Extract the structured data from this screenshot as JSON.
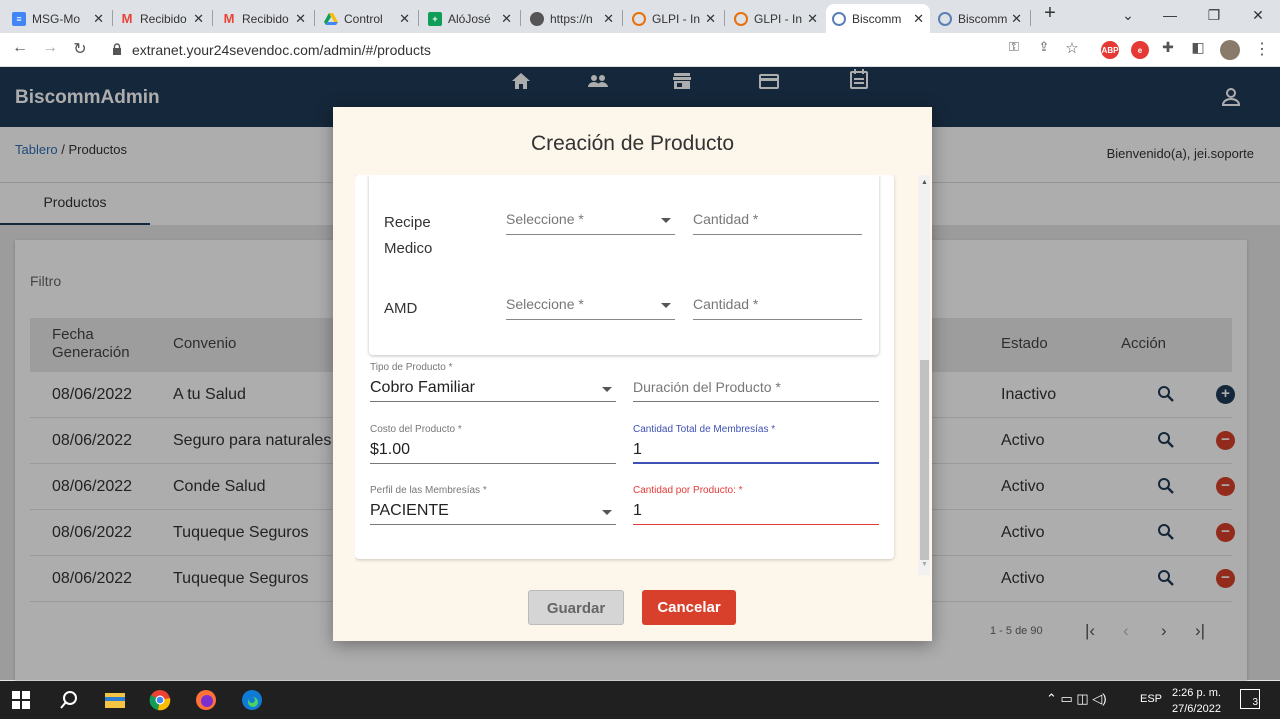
{
  "browser": {
    "tabs": [
      {
        "title": "MSG-Mo",
        "icon": "docs-icon",
        "color": "#4285f4"
      },
      {
        "title": "Recibido",
        "icon": "gmail-icon",
        "color": "#ea4335"
      },
      {
        "title": "Recibido",
        "icon": "gmail-icon",
        "color": "#ea4335"
      },
      {
        "title": "Control",
        "icon": "drive-icon",
        "color": "#fbbc04"
      },
      {
        "title": "AlóJosé",
        "icon": "sheets-icon",
        "color": "#0f9d58"
      },
      {
        "title": "https://n",
        "icon": "globe-icon",
        "color": "#555555"
      },
      {
        "title": "GLPI - In",
        "icon": "glpi-icon",
        "color": "#e8710a"
      },
      {
        "title": "GLPI - In",
        "icon": "glpi-icon",
        "color": "#e8710a"
      },
      {
        "title": "Biscomm",
        "icon": "biscomm-icon",
        "color": "#5b7fb8"
      },
      {
        "title": "Biscomm",
        "icon": "biscomm-icon",
        "color": "#5b7fb8"
      }
    ],
    "url": "extranet.your24sevendoc.com/admin/#/products"
  },
  "app": {
    "brand": "BiscommAdmin",
    "breadcrumb_link": "Tablero",
    "breadcrumb_current": " / Productos",
    "welcome": "Bienvenido(a), jei.soporte",
    "tab_label": "Productos",
    "filter_label": "Filtro",
    "columns": {
      "fecha": "Fecha Generación",
      "convenio": "Convenio",
      "estado": "Estado",
      "accion": "Acción"
    },
    "rows": [
      {
        "fecha": "08/06/2022",
        "convenio": "A tu Salud",
        "estado": "Inactivo",
        "action": "add"
      },
      {
        "fecha": "08/06/2022",
        "convenio": "Seguro para naturales",
        "estado": "Activo",
        "action": "remove"
      },
      {
        "fecha": "08/06/2022",
        "convenio": "Conde Salud",
        "estado": "Activo",
        "action": "remove"
      },
      {
        "fecha": "08/06/2022",
        "convenio": "Tuqueque Seguros",
        "estado": "Activo",
        "action": "remove"
      },
      {
        "fecha": "08/06/2022",
        "convenio": "Tuqueque Seguros",
        "estado": "Activo",
        "action": "remove"
      }
    ],
    "pager_text": "1 - 5 de 90"
  },
  "modal": {
    "title": "Creación de Producto",
    "documents": [
      {
        "name": "Recipe Medico",
        "select_placeholder": "Seleccione *",
        "qty_placeholder": "Cantidad *"
      },
      {
        "name": "AMD",
        "select_placeholder": "Seleccione *",
        "qty_placeholder": "Cantidad *"
      }
    ],
    "tipo_label": "Tipo de Producto *",
    "tipo_value": "Cobro Familiar",
    "duracion_placeholder": "Duración del Producto *",
    "costo_label": "Costo del Producto *",
    "costo_value": "$1.00",
    "total_label": "Cantidad Total de Membresías *",
    "total_value": "1",
    "perfil_label": "Perfil de las Membresías *",
    "perfil_value": "PACIENTE",
    "cantidad_label": "Cantidad por Producto: *",
    "cantidad_value": "1",
    "save_label": "Guardar",
    "cancel_label": "Cancelar"
  },
  "taskbar": {
    "language": "ESP",
    "time": "2:26 p. m.",
    "date": "27/6/2022",
    "notifications": "3"
  },
  "colors": {
    "header": "#1f3a56",
    "danger": "#d9402c",
    "add": "#1f3a56",
    "focus": "#3f51b5",
    "error": "#e53935"
  }
}
